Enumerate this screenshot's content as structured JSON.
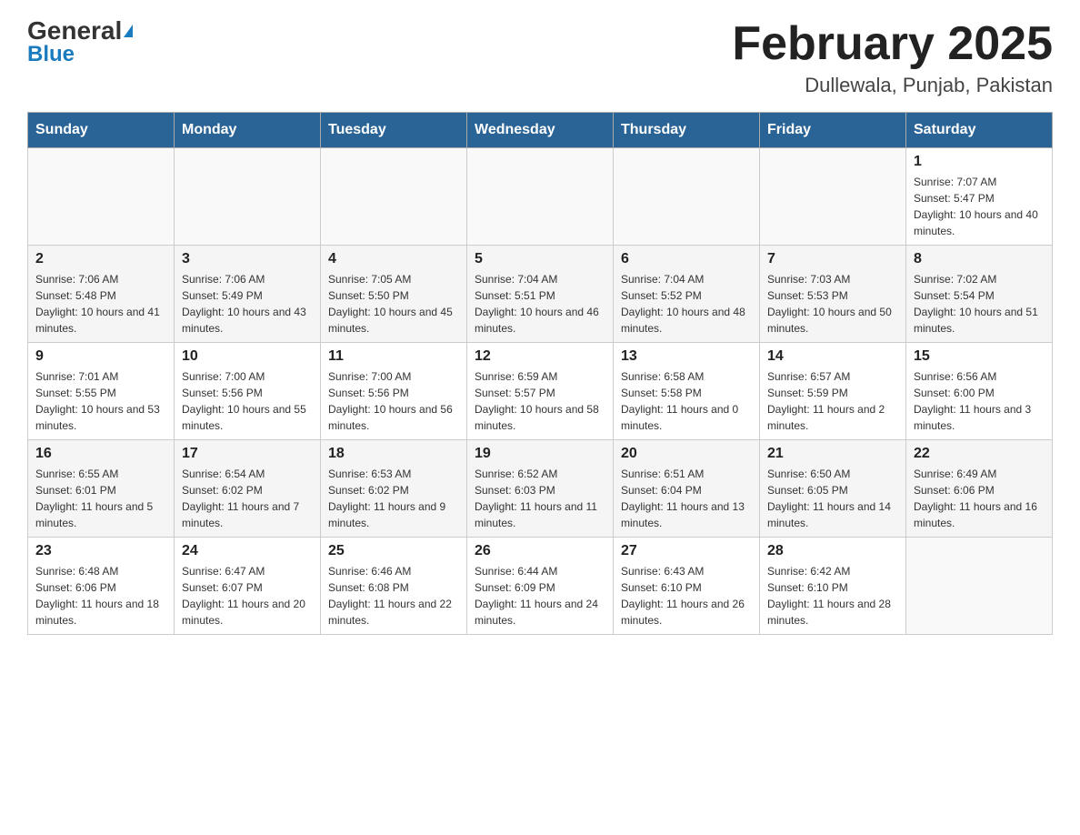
{
  "header": {
    "logo_general": "General",
    "logo_blue": "Blue",
    "month_title": "February 2025",
    "location": "Dullewala, Punjab, Pakistan"
  },
  "weekdays": [
    "Sunday",
    "Monday",
    "Tuesday",
    "Wednesday",
    "Thursday",
    "Friday",
    "Saturday"
  ],
  "rows": [
    {
      "cells": [
        {
          "day": "",
          "info": ""
        },
        {
          "day": "",
          "info": ""
        },
        {
          "day": "",
          "info": ""
        },
        {
          "day": "",
          "info": ""
        },
        {
          "day": "",
          "info": ""
        },
        {
          "day": "",
          "info": ""
        },
        {
          "day": "1",
          "info": "Sunrise: 7:07 AM\nSunset: 5:47 PM\nDaylight: 10 hours and 40 minutes."
        }
      ]
    },
    {
      "cells": [
        {
          "day": "2",
          "info": "Sunrise: 7:06 AM\nSunset: 5:48 PM\nDaylight: 10 hours and 41 minutes."
        },
        {
          "day": "3",
          "info": "Sunrise: 7:06 AM\nSunset: 5:49 PM\nDaylight: 10 hours and 43 minutes."
        },
        {
          "day": "4",
          "info": "Sunrise: 7:05 AM\nSunset: 5:50 PM\nDaylight: 10 hours and 45 minutes."
        },
        {
          "day": "5",
          "info": "Sunrise: 7:04 AM\nSunset: 5:51 PM\nDaylight: 10 hours and 46 minutes."
        },
        {
          "day": "6",
          "info": "Sunrise: 7:04 AM\nSunset: 5:52 PM\nDaylight: 10 hours and 48 minutes."
        },
        {
          "day": "7",
          "info": "Sunrise: 7:03 AM\nSunset: 5:53 PM\nDaylight: 10 hours and 50 minutes."
        },
        {
          "day": "8",
          "info": "Sunrise: 7:02 AM\nSunset: 5:54 PM\nDaylight: 10 hours and 51 minutes."
        }
      ]
    },
    {
      "cells": [
        {
          "day": "9",
          "info": "Sunrise: 7:01 AM\nSunset: 5:55 PM\nDaylight: 10 hours and 53 minutes."
        },
        {
          "day": "10",
          "info": "Sunrise: 7:00 AM\nSunset: 5:56 PM\nDaylight: 10 hours and 55 minutes."
        },
        {
          "day": "11",
          "info": "Sunrise: 7:00 AM\nSunset: 5:56 PM\nDaylight: 10 hours and 56 minutes."
        },
        {
          "day": "12",
          "info": "Sunrise: 6:59 AM\nSunset: 5:57 PM\nDaylight: 10 hours and 58 minutes."
        },
        {
          "day": "13",
          "info": "Sunrise: 6:58 AM\nSunset: 5:58 PM\nDaylight: 11 hours and 0 minutes."
        },
        {
          "day": "14",
          "info": "Sunrise: 6:57 AM\nSunset: 5:59 PM\nDaylight: 11 hours and 2 minutes."
        },
        {
          "day": "15",
          "info": "Sunrise: 6:56 AM\nSunset: 6:00 PM\nDaylight: 11 hours and 3 minutes."
        }
      ]
    },
    {
      "cells": [
        {
          "day": "16",
          "info": "Sunrise: 6:55 AM\nSunset: 6:01 PM\nDaylight: 11 hours and 5 minutes."
        },
        {
          "day": "17",
          "info": "Sunrise: 6:54 AM\nSunset: 6:02 PM\nDaylight: 11 hours and 7 minutes."
        },
        {
          "day": "18",
          "info": "Sunrise: 6:53 AM\nSunset: 6:02 PM\nDaylight: 11 hours and 9 minutes."
        },
        {
          "day": "19",
          "info": "Sunrise: 6:52 AM\nSunset: 6:03 PM\nDaylight: 11 hours and 11 minutes."
        },
        {
          "day": "20",
          "info": "Sunrise: 6:51 AM\nSunset: 6:04 PM\nDaylight: 11 hours and 13 minutes."
        },
        {
          "day": "21",
          "info": "Sunrise: 6:50 AM\nSunset: 6:05 PM\nDaylight: 11 hours and 14 minutes."
        },
        {
          "day": "22",
          "info": "Sunrise: 6:49 AM\nSunset: 6:06 PM\nDaylight: 11 hours and 16 minutes."
        }
      ]
    },
    {
      "cells": [
        {
          "day": "23",
          "info": "Sunrise: 6:48 AM\nSunset: 6:06 PM\nDaylight: 11 hours and 18 minutes."
        },
        {
          "day": "24",
          "info": "Sunrise: 6:47 AM\nSunset: 6:07 PM\nDaylight: 11 hours and 20 minutes."
        },
        {
          "day": "25",
          "info": "Sunrise: 6:46 AM\nSunset: 6:08 PM\nDaylight: 11 hours and 22 minutes."
        },
        {
          "day": "26",
          "info": "Sunrise: 6:44 AM\nSunset: 6:09 PM\nDaylight: 11 hours and 24 minutes."
        },
        {
          "day": "27",
          "info": "Sunrise: 6:43 AM\nSunset: 6:10 PM\nDaylight: 11 hours and 26 minutes."
        },
        {
          "day": "28",
          "info": "Sunrise: 6:42 AM\nSunset: 6:10 PM\nDaylight: 11 hours and 28 minutes."
        },
        {
          "day": "",
          "info": ""
        }
      ]
    }
  ]
}
